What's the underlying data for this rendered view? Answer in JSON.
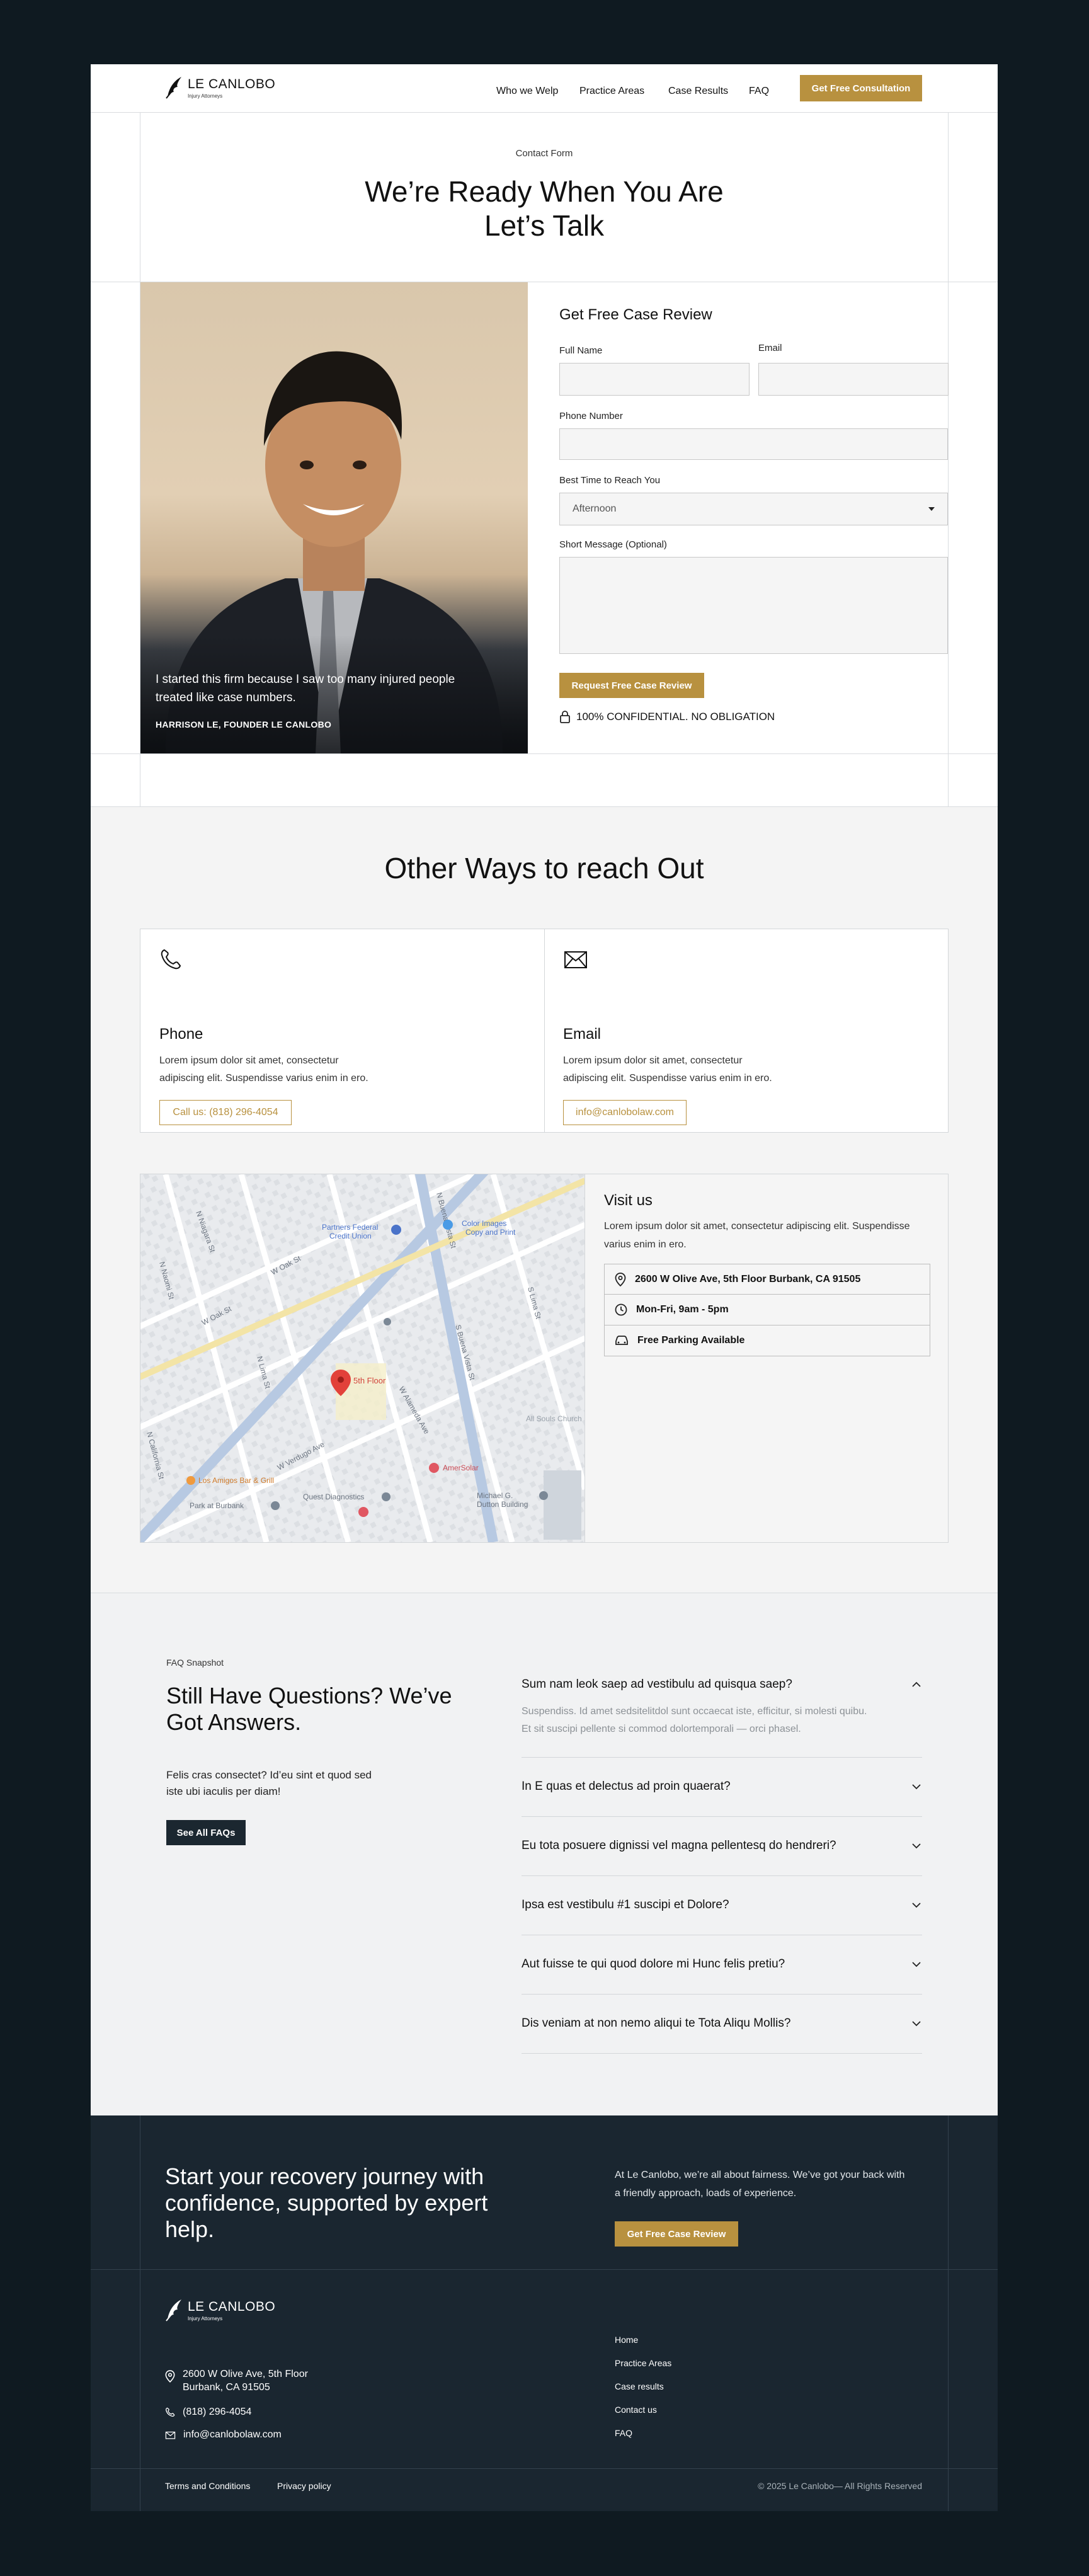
{
  "brand": {
    "name": "LE CANLOBO",
    "tagline": "Injury Attorneys"
  },
  "nav": {
    "items": [
      "Who we Welp",
      "Practice Areas",
      "Case Results",
      "FAQ"
    ],
    "cta": "Get Free Consultation"
  },
  "hero": {
    "eyebrow": "Contact Form",
    "title_line1": "We’re Ready When You Are",
    "title_line2": "Let’s Talk"
  },
  "quote": {
    "text_line1": "I started this firm because I saw too many injured people",
    "text_line2": "treated like case numbers.",
    "author": "HARRISON LE, FOUNDER LE CANLOBO"
  },
  "form": {
    "title": "Get Free Case Review",
    "full_name_label": "Full Name",
    "email_label": "Email",
    "phone_label": "Phone Number",
    "time_label": "Best Time to Reach You",
    "time_value": "Afternoon",
    "message_label": "Short Message (Optional)",
    "submit": "Request Free Case Review",
    "confidential": "100% CONFIDENTIAL. NO OBLIGATION"
  },
  "other_ways": {
    "title": "Other Ways to reach Out",
    "phone": {
      "title": "Phone",
      "text_line1": "Lorem ipsum dolor sit amet, consectetur",
      "text_line2": "adipiscing elit. Suspendisse varius enim in ero.",
      "button": "Call us: (818) 296-4054"
    },
    "email": {
      "title": "Email",
      "text_line1": "Lorem ipsum dolor sit amet, consectetur",
      "text_line2": "adipiscing elit. Suspendisse varius enim in ero.",
      "button": "info@canlobolaw.com"
    }
  },
  "map": {
    "streets": [
      "N Niagara St",
      "N Naomi St",
      "W Olive Ave",
      "N Ontario St",
      "W Oak St",
      "N Buena Vista St",
      "W Verdugo Ave",
      "N Pass Ave",
      "N Hollywood Way",
      "S Buena Vista St",
      "N Lima St",
      "N California St",
      "S Lima St",
      "W Alameda Ave",
      "N Bel Aire Dr"
    ],
    "places": [
      "Partners Federal Credit Union",
      "Color Images Copy and Print",
      "5th Floor",
      "Los Amigos Bar & Grill",
      "Quest Diagnostics",
      "AmerSolar",
      "All Souls Church",
      "Michael G. Dutton Building",
      "Park at Burbank"
    ]
  },
  "visit": {
    "title": "Visit us",
    "text_line1": "Lorem ipsum dolor sit amet, consectetur adipiscing elit. Suspendisse",
    "text_line2": "varius enim in ero.",
    "address": "2600 W Olive Ave, 5th Floor Burbank, CA 91505",
    "hours": "Mon-Fri, 9am - 5pm",
    "parking": "Free Parking Available"
  },
  "faq": {
    "eyebrow": "FAQ Snapshot",
    "title_line1": "Still Have Questions? We’ve",
    "title_line2": "Got Answers.",
    "text_line1": "Felis cras consectet? Id’eu sint et quod sed",
    "text_line2": "iste ubi iaculis per diam!",
    "button": "See All FAQs",
    "items": [
      {
        "q": "Sum nam leok saep ad vestibulu ad quisqua saep?",
        "a_line1": "Suspendiss. Id amet sedsitelitdol sunt occaecat iste, efficitur, si molesti quibu.",
        "a_line2": "Et sit suscipi pellente si commod dolortemporali — orci phasel."
      },
      {
        "q": "In E quas et delectus ad proin quaerat?"
      },
      {
        "q": "Eu tota posuere dignissi vel magna pellentesq do hendreri?"
      },
      {
        "q": "Ipsa est vestibulu #1 suscipi et Dolore?"
      },
      {
        "q": "Aut fuisse te qui quod dolore mi Hunc felis pretiu?"
      },
      {
        "q": "Dis veniam at non nemo aliqui te Tota Aliqu Mollis?"
      }
    ]
  },
  "cta": {
    "title_line1": "Start your recovery journey with",
    "title_line2": "confidence, supported by expert",
    "title_line3": "help.",
    "text_line1": "At Le Canlobo, we’re all about fairness. We’ve got your back with",
    "text_line2": "a friendly approach, loads of experience.",
    "button": "Get Free Case Review"
  },
  "footer": {
    "address_line1": "2600 W Olive Ave, 5th Floor",
    "address_line2": "Burbank, CA 91505",
    "phone": "(818) 296-4054",
    "email": "info@canlobolaw.com",
    "links": [
      "Home",
      "Practice Areas",
      "Case results",
      "Contact us",
      "FAQ"
    ],
    "legal": [
      "Terms and Conditions",
      "Privacy policy"
    ],
    "copyright": "© 2025 Le Canlobo— All Rights Reserved"
  },
  "colors": {
    "gold": "#b8913f",
    "dark": "#1a2630",
    "outer": "#0f1a21",
    "grey_bg": "#f4f4f4"
  }
}
